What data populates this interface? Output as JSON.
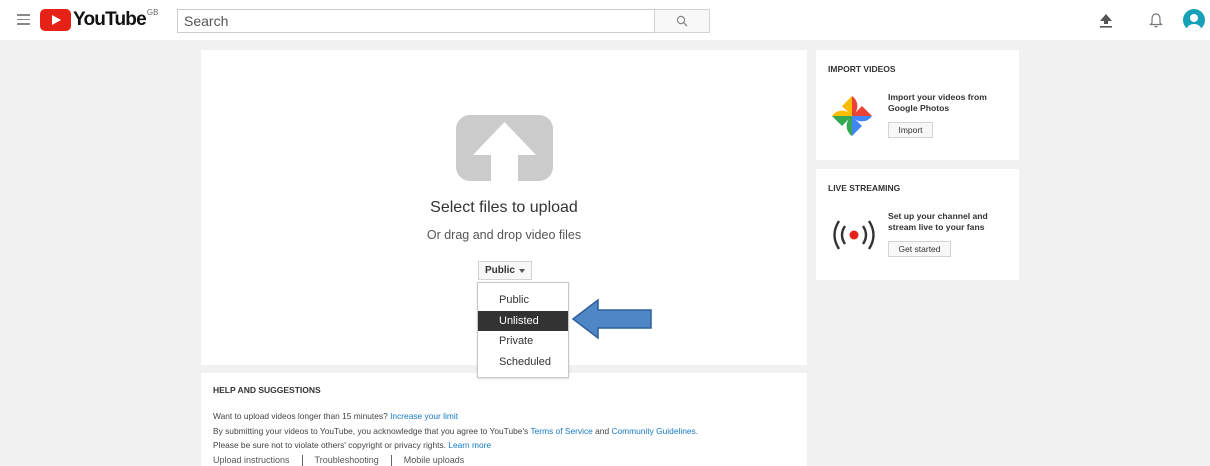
{
  "header": {
    "logo_text": "YouTube",
    "region": "GB",
    "search_placeholder": "Search"
  },
  "upload": {
    "title": "Select files to upload",
    "subtitle": "Or drag and drop video files",
    "privacy_selected": "Public"
  },
  "privacy_dropdown": {
    "options": [
      "Public",
      "Unlisted",
      "Private",
      "Scheduled"
    ],
    "highlighted": "Unlisted"
  },
  "help": {
    "title": "HELP AND SUGGESTIONS",
    "line1_text": "Want to upload videos longer than 15 minutes? ",
    "line1_link": "Increase your limit",
    "line2_text1": "By submitting your videos to YouTube, you acknowledge that you agree to YouTube's ",
    "line2_link1": "Terms of Service",
    "line2_text2": " and ",
    "line2_link2": "Community Guidelines",
    "line2_text3": ".",
    "line3_text": "Please be sure not to violate others' copyright or privacy rights. ",
    "line3_link": "Learn more",
    "links": [
      "Upload instructions",
      "Troubleshooting",
      "Mobile uploads"
    ]
  },
  "import_videos": {
    "title": "IMPORT VIDEOS",
    "text": "Import your videos from Google Photos",
    "button": "Import"
  },
  "live_streaming": {
    "title": "LIVE STREAMING",
    "text": "Set up your channel and stream live to your fans",
    "button": "Get started"
  },
  "colors": {
    "brand_red": "#e62117",
    "link_blue": "#167ac6",
    "annotation_arrow": "#4f86c6",
    "avatar": "#16a1b8"
  },
  "icons": [
    "menu-icon",
    "search-icon",
    "upload-icon",
    "bell-icon",
    "avatar-icon",
    "upload-arrow-icon",
    "google-photos-icon",
    "live-broadcast-icon",
    "arrow-annotation"
  ]
}
